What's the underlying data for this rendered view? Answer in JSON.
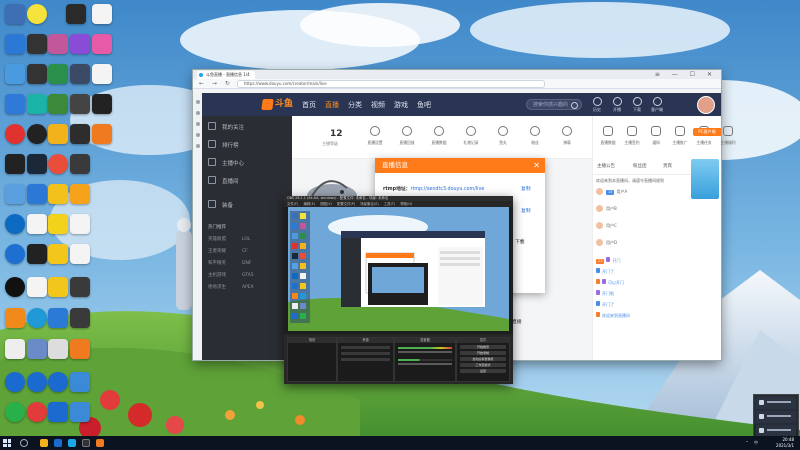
{
  "browser": {
    "tab_title": "斗鱼直播 - 直播信息 1/4",
    "url": "https://www.douyu.com/creator/main/live",
    "window_controls": "≡ — ☐ ✕",
    "nav_glyphs": "← → ↻"
  },
  "site": {
    "logo_text": "斗鱼",
    "nav": [
      "首页",
      "直播",
      "分类",
      "视频",
      "游戏",
      "鱼吧"
    ],
    "active_nav_index": 1,
    "search_placeholder": "搜索你感兴趣的",
    "tools": [
      "历史",
      "开播",
      "下载",
      "客户端"
    ],
    "sidebar": [
      "我的关注",
      "排行榜",
      "主播中心",
      "直播间",
      "装备"
    ],
    "sidebar_sub_header": "热门推荐",
    "sidebar_sub": [
      [
        "英雄联盟",
        "LOL"
      ],
      [
        "王者荣耀",
        "CF"
      ],
      [
        "和平精英",
        "DNF"
      ],
      [
        "主机游戏",
        "GTA5"
      ],
      [
        "绝地求生",
        "APEX"
      ]
    ],
    "stat_num": "12",
    "stat_caption": "主播等级",
    "feature_icons": [
      "直播设置",
      "直播回放",
      "直播数据",
      "礼物记录",
      "鱼丸",
      "粉丝",
      "弹幕"
    ],
    "chat_icons": [
      "直播数据",
      "主播签约",
      "通知",
      "主播推广",
      "主播任务",
      "主播福利"
    ],
    "pc_client": "PC客户端",
    "chat_header": [
      "主播公告",
      "粉丝团",
      "贵宾"
    ],
    "chat_lines": [
      {
        "badge": "",
        "user": "",
        "text": "欢迎来到本直播间，请遵守直播间规则"
      },
      {
        "badge": "15",
        "user": "",
        "text": "用户A"
      },
      {
        "badge": "",
        "user": "",
        "text": "用户B"
      },
      {
        "badge": "",
        "user": "",
        "text": "用户C"
      },
      {
        "badge": "",
        "user": "",
        "text": "用户D"
      },
      {
        "badge": "23",
        "user": "",
        "text": "开门"
      },
      {
        "badge": "",
        "user": "",
        "text": "开门了"
      },
      {
        "badge": "",
        "user": "",
        "text": "可以开门"
      },
      {
        "badge": "",
        "user": "",
        "text": "开门啦"
      },
      {
        "badge": "",
        "user": "",
        "text": "开门了"
      },
      {
        "badge": "",
        "user": "",
        "text": "欢迎来到直播间"
      }
    ]
  },
  "dialog": {
    "title": "直播信息",
    "close": "✕",
    "rtmp_label": "rtmp地址：",
    "rtmp_value": "rtmp://sendtc3.douyu.com/live",
    "code_label": "直播码：",
    "code_value": "",
    "copy": "复制",
    "note_1": "下載",
    "note_2": "直播"
  },
  "obs": {
    "title": "OBS 26.1.1 (64-bit, windows) - 配置文件: 未命名 - 场景: 未命名",
    "menu": [
      "文件(F)",
      "编辑(E)",
      "视图(V)",
      "配置文件(P)",
      "场景集合(S)",
      "工具(T)",
      "帮助(H)"
    ],
    "docks": [
      "场景",
      "来源",
      "混音器",
      "转场特效",
      "控件"
    ],
    "controls": [
      "开始推流",
      "开始录制",
      "启动虚拟摄像机",
      "工作室模式",
      "设置",
      "退出"
    ]
  },
  "taskbar": {
    "time": "20:48",
    "date": "2021/3/1",
    "tray": "⌃ 中"
  },
  "colors": {
    "accent": "#ff7a18",
    "site_nav_bg": "#2a3553",
    "sidebar_bg": "#2a2d33",
    "taskbar_bg": "#0b1320"
  }
}
